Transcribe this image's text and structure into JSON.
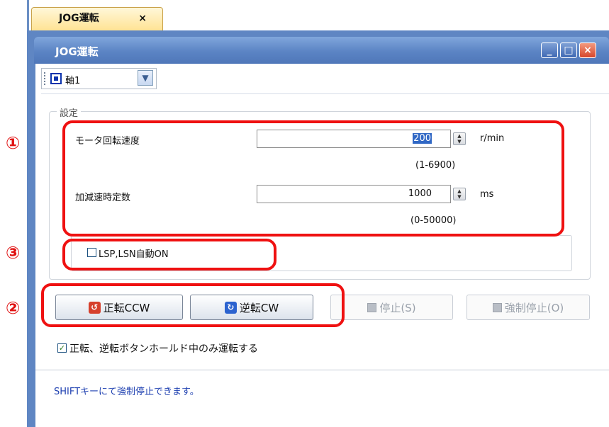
{
  "tab": {
    "label": "JOG運転",
    "close": "×"
  },
  "window": {
    "title": "JOG運転",
    "controls": {
      "minimize": "_",
      "maximize": "□",
      "close": "×"
    }
  },
  "axis": {
    "selected": "軸1",
    "dropdown_icon": "chevron-down-icon"
  },
  "settings": {
    "group_label": "設定",
    "motor_speed": {
      "label": "モータ回転速度",
      "value": "200",
      "unit": "r/min",
      "range": "(1-6900)"
    },
    "accel_time": {
      "label": "加減速時定数",
      "value": "1000",
      "unit": "ms",
      "range": "(0-50000)"
    },
    "lsp_lsn": {
      "label": "LSP,LSN自動ON",
      "checked": false
    }
  },
  "buttons": {
    "forward": "正転CCW",
    "reverse": "逆転CW",
    "stop": "停止(S)",
    "forced_stop": "強制停止(O)"
  },
  "hold_option": {
    "label": "正転、逆転ボタンホールド中のみ運転する",
    "checked": true,
    "check_mark": "✓"
  },
  "footer": {
    "message": "SHIFTキーにて強制停止できます。"
  },
  "annotations": {
    "marker1": "①",
    "marker2": "②",
    "marker3": "③",
    "color": "#ef1111"
  },
  "colors": {
    "title_bar": "#5b84c4",
    "selection": "#3168c5",
    "footer_text": "#1d3fb0"
  }
}
